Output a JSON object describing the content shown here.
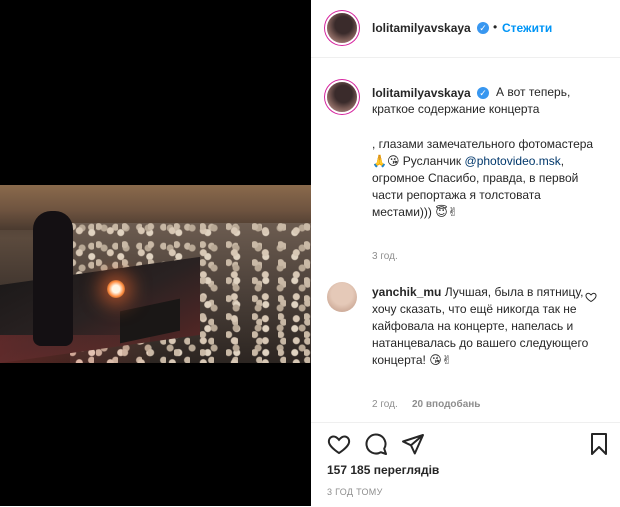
{
  "post": {
    "author": "lolitamilyavskaya",
    "verified": true,
    "follow_label": "Стежити",
    "separator": "•"
  },
  "caption": {
    "author": "lolitamilyavskaya",
    "line1": "А вот теперь, краткое содержание концерта",
    "line2": ", глазами замечательного фотомастера🙏😘 Русланчик",
    "mention": "@photovideo.msk",
    "line3": ", огромное Спасибо, правда, в первой части репортажа я толстовата местами))) 😇✌",
    "time": "3 год."
  },
  "comment": {
    "author": "yanchik_mu",
    "text": "Лучшая, была в пятницу, хочу сказать, что ещё никогда так не кайфовала на концерте, напелась и натанцевалась до вашего следующего концерта! 😘✌",
    "time": "2 год.",
    "likes": "20 вподобань"
  },
  "stats": {
    "views": "157 185 переглядів",
    "timestamp": "3 ГОД ТОМУ"
  },
  "colors": {
    "accent": "#0095f6",
    "verified": "#3897f0",
    "muted": "#8e8e8e",
    "text": "#262626"
  },
  "icons": {
    "like": "heart-icon",
    "comment": "comment-icon",
    "share": "paper-plane-icon",
    "save": "bookmark-icon"
  }
}
